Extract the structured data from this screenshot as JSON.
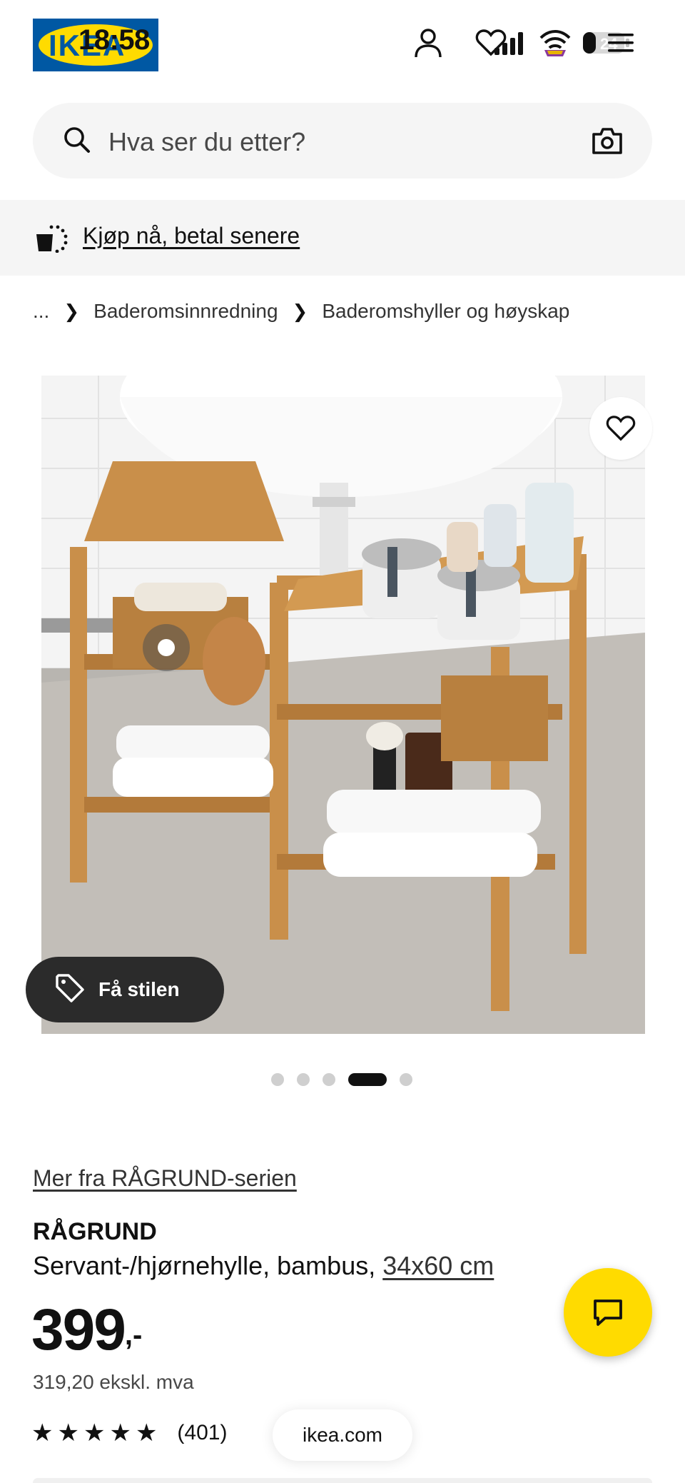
{
  "header": {
    "logo_text": "IKEA",
    "status_time": "18:58",
    "battery_level": "24",
    "icons": [
      "profile-icon",
      "heart-icon",
      "signal-icon",
      "wifi-icon",
      "battery-icon",
      "menu-icon"
    ]
  },
  "search": {
    "placeholder": "Hva ser du etter?"
  },
  "banner": {
    "link_text": "Kjøp nå, betal senere"
  },
  "breadcrumb": {
    "ellipsis": "...",
    "items": [
      "Baderomsinnredning",
      "Baderomshyller og høyskap"
    ]
  },
  "gallery": {
    "style_button_label": "Få stilen",
    "dot_count": 5,
    "active_dot": 3
  },
  "product": {
    "series_link": "Mer fra RÅGRUND-serien",
    "name": "RÅGRUND",
    "description": "Servant-/hjørnehylle, bambus, ",
    "size_link": "34x60 cm",
    "price": "399",
    "price_suffix": ",-",
    "price_ex_vat": "319,20 ekskl. mva",
    "rating_value": 5,
    "review_count": "(401)"
  },
  "browser": {
    "url": "ikea.com"
  },
  "colors": {
    "ikea_blue": "#0058a3",
    "ikea_yellow": "#ffdb00",
    "dark_button": "#2b2b2b"
  }
}
